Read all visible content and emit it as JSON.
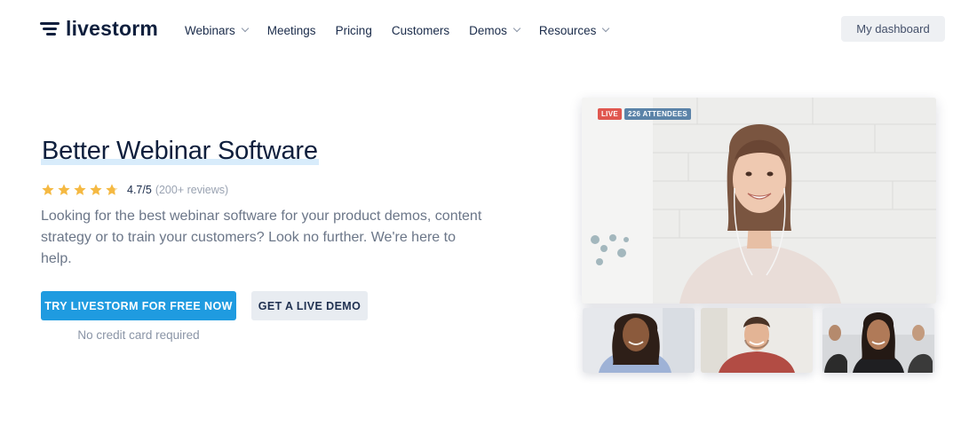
{
  "nav": {
    "logo_text": "livestorm",
    "items": [
      {
        "label": "Webinars",
        "dropdown": true
      },
      {
        "label": "Meetings",
        "dropdown": false
      },
      {
        "label": "Pricing",
        "dropdown": false
      },
      {
        "label": "Customers",
        "dropdown": false
      },
      {
        "label": "Demos",
        "dropdown": true
      },
      {
        "label": "Resources",
        "dropdown": true
      }
    ],
    "dashboard_label": "My dashboard"
  },
  "hero": {
    "title_highlight": "Better Webinar Software",
    "rating": {
      "stars": 4.7,
      "max": 5,
      "score_text": "4.7/5",
      "reviews_text": "(200+ reviews)"
    },
    "description": "Looking for the best webinar software for your product demos, content strategy or to train your customers? Look no further. We're here to help.",
    "cta_label": "TRY LIVESTORM FOR FREE NOW",
    "demo_label": "GET A LIVE DEMO",
    "note": "No credit card required"
  },
  "video": {
    "live_badge": "LIVE",
    "attendees_badge": "226 ATTENDEES"
  },
  "colors": {
    "brand_blue": "#1f9be0",
    "star": "#f5b942",
    "live_red": "#e0574f",
    "attendees_blue": "#5b83a8"
  },
  "icons": {
    "logo": "livestorm-logo-icon",
    "star": "star-icon",
    "chevron": "chevron-down-icon"
  }
}
